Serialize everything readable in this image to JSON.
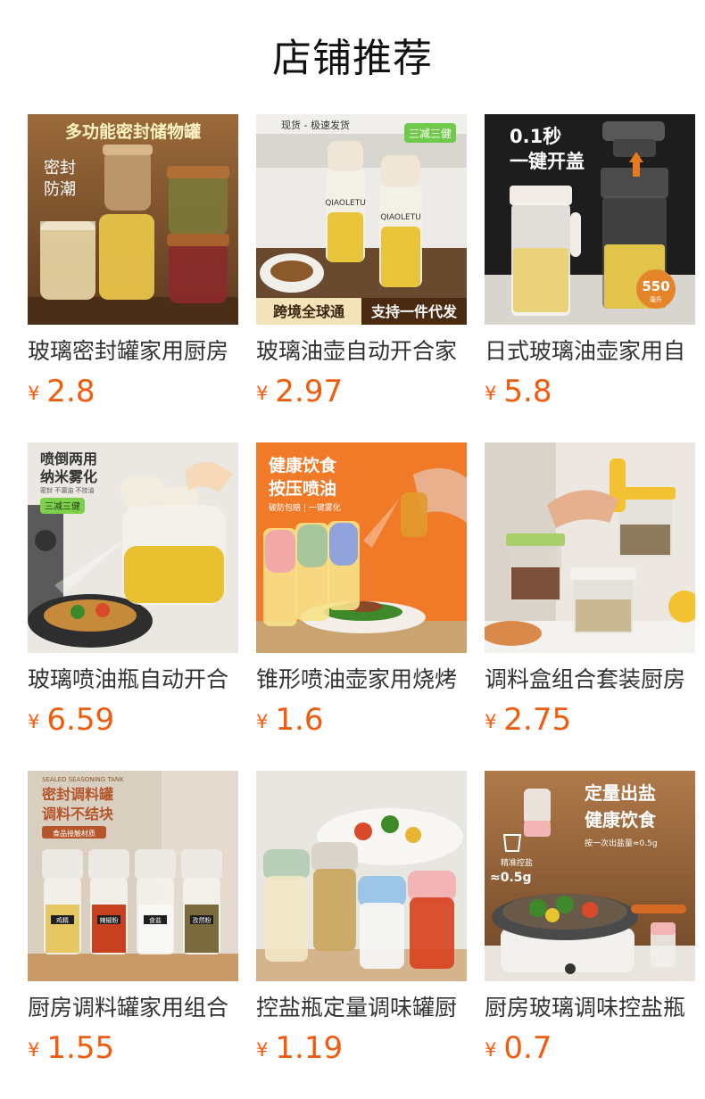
{
  "section": {
    "title": "店铺推荐",
    "currency": "¥"
  },
  "products": [
    {
      "name": "玻璃密封罐家用厨房",
      "price": "2.8",
      "image": {
        "icon": "glass-storage-jars",
        "bg": "#8a5a2c",
        "texts": [
          "多功能密封储物罐",
          "密封",
          "防潮"
        ]
      }
    },
    {
      "name": "玻璃油壶自动开合家",
      "price": "2.97",
      "image": {
        "icon": "glass-oil-bottles",
        "bg": "#e9e7e3",
        "texts": [
          "现货 - 极速发货",
          "三减三健",
          "跨境全球通",
          "支持一件代发",
          "QIAOLETU",
          "QIAOLETU"
        ]
      }
    },
    {
      "name": "日式玻璃油壶家用自",
      "price": "5.8",
      "image": {
        "icon": "oil-pot-auto-lid",
        "bg": "#1c1c1c",
        "texts": [
          "0.1秒",
          "一键开盖",
          "550",
          "毫升"
        ]
      }
    },
    {
      "name": "玻璃喷油瓶自动开合",
      "price": "6.59",
      "image": {
        "icon": "oil-spray-pot",
        "bg": "#e7e4df",
        "texts": [
          "喷倒两用",
          "纳米雾化",
          "密封 不漏油 不挂油",
          "三减三健"
        ]
      }
    },
    {
      "name": "锥形喷油壶家用烧烤",
      "price": "1.6",
      "image": {
        "icon": "cone-spray-bottles",
        "bg": "#f07a28",
        "texts": [
          "健康饮食",
          "按压喷油",
          "破防包赔 | 一键雾化"
        ]
      }
    },
    {
      "name": "调料盒组合套装厨房",
      "price": "2.75",
      "image": {
        "icon": "seasoning-box-set",
        "bg": "#e9e5de",
        "texts": []
      }
    },
    {
      "name": "厨房调料罐家用组合",
      "price": "1.55",
      "image": {
        "icon": "seasoning-jars",
        "bg": "#d7cdbf",
        "texts": [
          "SEALED SEASONING TANK",
          "密封调料罐",
          "调料不结块",
          "食品接触材质",
          "鸡精",
          "辣椒粉",
          "食盐",
          "孜然粉"
        ]
      }
    },
    {
      "name": "控盐瓶定量调味罐厨",
      "price": "1.19",
      "image": {
        "icon": "salt-control-bottles",
        "bg": "#e6e4df",
        "texts": []
      }
    },
    {
      "name": "厨房玻璃调味控盐瓶",
      "price": "0.7",
      "image": {
        "icon": "salt-dispenser-cooking",
        "bg": "#9a6a42",
        "texts": [
          "定量出盐",
          "健康饮食",
          "按一次出盐量≈0.5g",
          "精准控盐",
          "≈0.5g"
        ]
      }
    }
  ]
}
